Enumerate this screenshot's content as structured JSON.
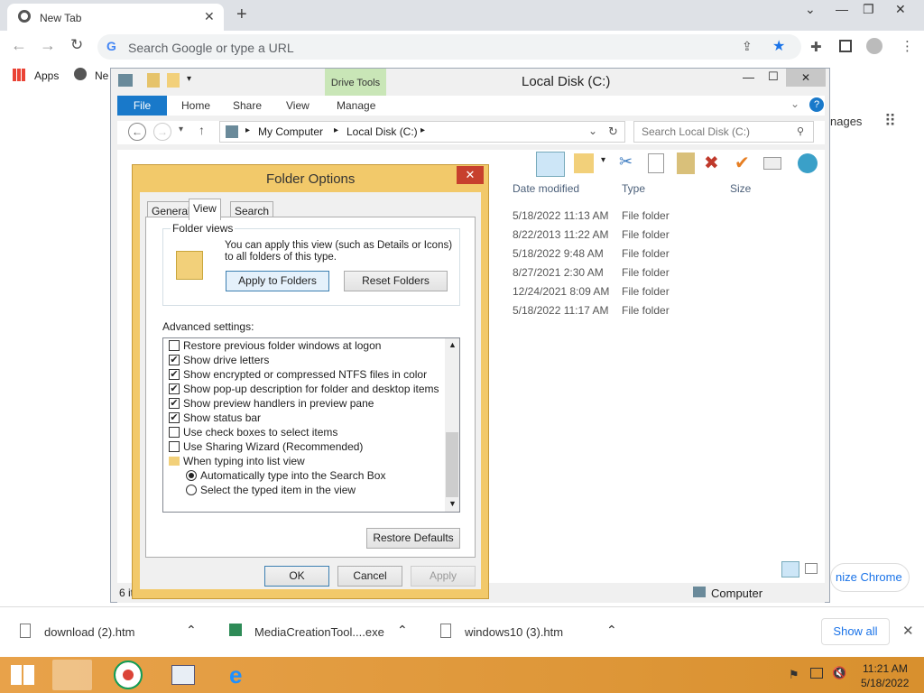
{
  "browser": {
    "tab_title": "New Tab",
    "omnibox_placeholder": "Search Google or type a URL",
    "bookmarks": [
      "Apps",
      "Ne"
    ],
    "right_fragments": {
      "images": "nages",
      "customize": "nize Chrome"
    }
  },
  "explorer": {
    "title": "Local Disk (C:)",
    "drive_tools": "Drive Tools",
    "tabs": [
      "File",
      "Home",
      "Share",
      "View",
      "Manage"
    ],
    "breadcrumb": [
      "My Computer",
      "Local Disk (C:)"
    ],
    "search_placeholder": "Search Local Disk (C:)",
    "columns": [
      "Date modified",
      "Type",
      "Size"
    ],
    "rows": [
      {
        "date": "5/18/2022 11:13 AM",
        "type": "File folder"
      },
      {
        "date": "8/22/2013 11:22 AM",
        "type": "File folder"
      },
      {
        "date": "5/18/2022 9:48 AM",
        "type": "File folder"
      },
      {
        "date": "8/27/2021 2:30 AM",
        "type": "File folder"
      },
      {
        "date": "12/24/2021 8:09 AM",
        "type": "File folder"
      },
      {
        "date": "5/18/2022 11:17 AM",
        "type": "File folder"
      }
    ],
    "status_left": "6 it",
    "status_right": "Computer"
  },
  "dialog": {
    "title": "Folder Options",
    "tabs": [
      "General",
      "View",
      "Search"
    ],
    "folder_views_label": "Folder views",
    "folder_views_text": "You can apply this view (such as Details or Icons) to all folders of this type.",
    "apply_folders": "Apply to Folders",
    "reset_folders": "Reset Folders",
    "advanced_label": "Advanced settings:",
    "items": [
      {
        "label": "Restore previous folder windows at logon",
        "checked": false
      },
      {
        "label": "Show drive letters",
        "checked": true
      },
      {
        "label": "Show encrypted or compressed NTFS files in color",
        "checked": true
      },
      {
        "label": "Show pop-up description for folder and desktop items",
        "checked": true
      },
      {
        "label": "Show preview handlers in preview pane",
        "checked": true
      },
      {
        "label": "Show status bar",
        "checked": true
      },
      {
        "label": "Use check boxes to select items",
        "checked": false
      },
      {
        "label": "Use Sharing Wizard (Recommended)",
        "checked": false
      },
      {
        "label": "When typing into list view"
      },
      {
        "label": "Automatically type into the Search Box",
        "radio": true
      },
      {
        "label": "Select the typed item in the view",
        "radio": false
      }
    ],
    "restore_defaults": "Restore Defaults",
    "ok": "OK",
    "cancel": "Cancel",
    "apply": "Apply"
  },
  "downloads": {
    "items": [
      "download (2).htm",
      "MediaCreationTool....exe",
      "windows10 (3).htm"
    ],
    "show_all": "Show all"
  },
  "taskbar": {
    "time": "11:21 AM",
    "date": "5/18/2022"
  }
}
